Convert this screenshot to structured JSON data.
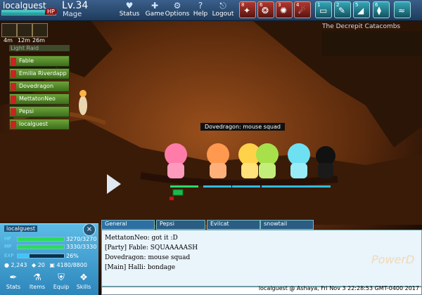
{
  "player": {
    "name": "localguest",
    "hp_badge": "HP",
    "level": "Lv.34",
    "class": "Mage"
  },
  "menu": [
    {
      "label": "Status",
      "icon": "heart-icon"
    },
    {
      "label": "Game",
      "icon": "gamepad-icon"
    },
    {
      "label": "Options",
      "icon": "gear-icon"
    },
    {
      "label": "Help",
      "icon": "help-icon"
    },
    {
      "label": "Logout",
      "icon": "logout-icon"
    }
  ],
  "skills": [
    {
      "key": "8",
      "icon": "skill-8-icon",
      "color": "red"
    },
    {
      "key": "6",
      "icon": "skill-6-icon",
      "color": "red"
    },
    {
      "key": "3",
      "icon": "skill-3-icon",
      "color": "red"
    },
    {
      "key": "4",
      "icon": "skill-4-icon",
      "color": "red"
    },
    {
      "key": "1",
      "icon": "skill-1-icon",
      "color": "teal"
    },
    {
      "key": "2",
      "icon": "skill-2-icon",
      "color": "teal"
    },
    {
      "key": "5",
      "icon": "skill-5-icon",
      "color": "teal"
    },
    {
      "key": "6",
      "icon": "skill-6b-icon",
      "color": "teal"
    }
  ],
  "buffs": [
    {
      "time": "4m",
      "icon": "buff-1-icon"
    },
    {
      "time": "12m",
      "icon": "buff-2-icon"
    },
    {
      "time": "26m",
      "icon": "buff-3-icon"
    }
  ],
  "zone": {
    "name": "The Decrepit Catacombs"
  },
  "raid": {
    "title": "Light Raid",
    "members": [
      "Fable",
      "Emilia Riverdapp",
      "Dovedragon",
      "MettatonNeo",
      "Pepsi",
      "localguest"
    ]
  },
  "nametag": "Dovedragon: mouse squad",
  "status": {
    "name": "localguest",
    "hp": {
      "label": "HP",
      "value": "3270/3270",
      "fill": 1.0
    },
    "mp": {
      "label": "MP",
      "value": "3330/3330",
      "fill": 1.0
    },
    "exp": {
      "label": "EXP",
      "value": "26%",
      "fill": 0.26
    },
    "currency": "2,243",
    "gems": "20",
    "storage": "4180/8800",
    "buttons": [
      {
        "label": "Stats",
        "icon": "stats-icon"
      },
      {
        "label": "Items",
        "icon": "items-icon"
      },
      {
        "label": "Equip",
        "icon": "equip-icon"
      },
      {
        "label": "Skills",
        "icon": "skills-icon"
      }
    ]
  },
  "chat": {
    "tabs": [
      "General",
      "Pepsi",
      "Evilcat",
      "snowtail"
    ],
    "lines": [
      "MettatonNeo: got it :D",
      "[Party] Fable: SQUAAAAASH",
      "Dovedragon: mouse squad",
      "[Main] Halli: bondage"
    ],
    "footer": "localguest @ Ashaya, Fri Nov 3 22:28:53 GMT-0400 2017"
  },
  "brand": "PowerD",
  "colors": {
    "accent": "#2e6fa3",
    "hp": "#2bdc5a",
    "mp": "#2bdc5a",
    "exp": "#3cc6ff"
  }
}
